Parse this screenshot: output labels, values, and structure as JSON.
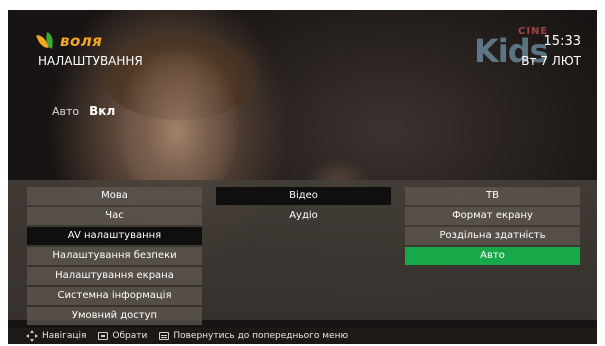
{
  "header": {
    "brand": "воля",
    "title": "НАЛАШТУВАННЯ",
    "time": "15:33",
    "date": "Вт 7 ЛЮТ",
    "channel_logo": {
      "main": "Kids",
      "sub": "CINE"
    }
  },
  "status": {
    "label": "Авто",
    "value": "Вкл"
  },
  "menu": {
    "main": [
      {
        "label": "Мова"
      },
      {
        "label": "Час"
      },
      {
        "label": "AV налаштування"
      },
      {
        "label": "Налаштування безпеки"
      },
      {
        "label": "Налаштування екрана"
      },
      {
        "label": "Системна інформація"
      },
      {
        "label": "Умовний доступ"
      }
    ],
    "sub": [
      {
        "label": "Відео"
      },
      {
        "label": "Аудіо"
      }
    ],
    "options": [
      {
        "label": "ТВ"
      },
      {
        "label": "Формат екрану"
      },
      {
        "label": "Роздільна здатність"
      },
      {
        "label": "Авто"
      }
    ]
  },
  "footer": {
    "navigate": "Навігація",
    "select": "Обрати",
    "back": "Повернутись до попереднього меню"
  },
  "colors": {
    "accent_green": "#17a84a",
    "active_black": "#0f0f0f",
    "brand_orange": "#f5a623"
  }
}
